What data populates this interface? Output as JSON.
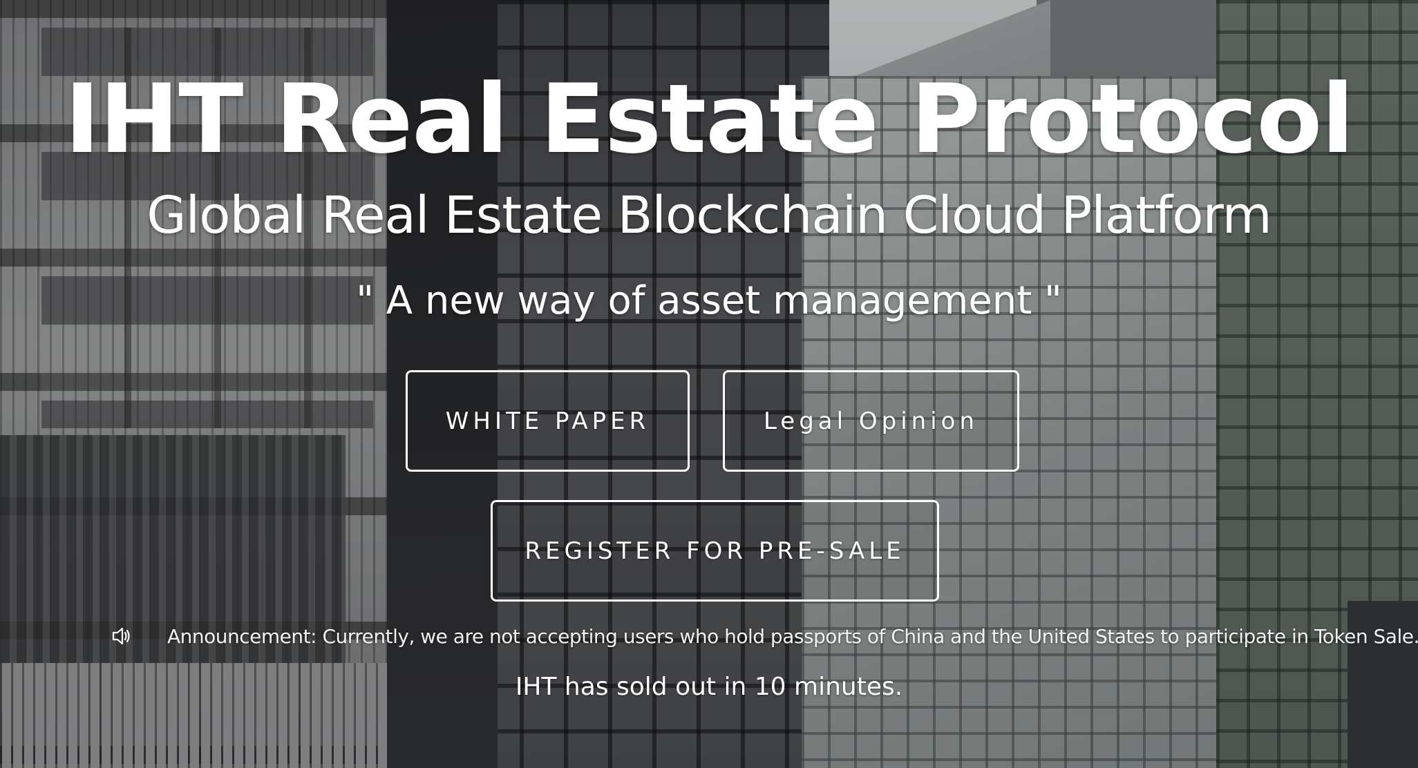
{
  "hero": {
    "title": "IHT Real Estate Protocol",
    "subtitle": "Global Real Estate Blockchain Cloud Platform",
    "tagline": "\" A new way of asset management \""
  },
  "buttons": {
    "white_paper": "WHITE PAPER",
    "legal_opinion": "Legal Opinion",
    "register_presale": "REGISTER FOR PRE-SALE"
  },
  "announcement": {
    "icon": "speaker-icon",
    "text": "Announcement: Currently, we are not accepting users who hold passports of China and the United States to participate in Token Sale."
  },
  "status": {
    "sold_out": "IHT has sold out in 10 minutes."
  },
  "colors": {
    "text": "#ffffff",
    "button_border": "#ffffff"
  }
}
